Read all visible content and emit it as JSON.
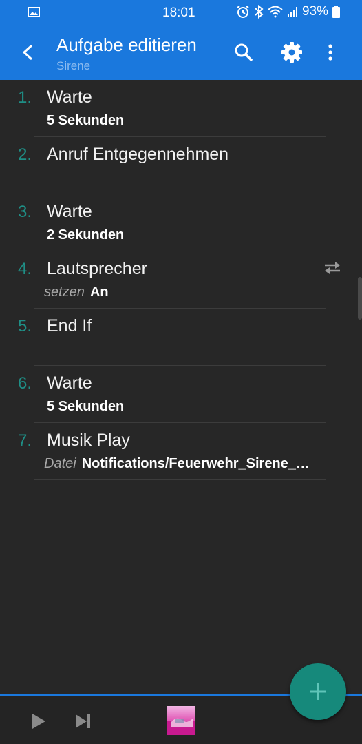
{
  "status_bar": {
    "time": "18:01",
    "battery": "93%"
  },
  "app_bar": {
    "title": "Aufgabe editieren",
    "subtitle": "Sirene"
  },
  "actions": [
    {
      "number": "1.",
      "name": "Warte",
      "detail_key": "",
      "detail_value": "5 Sekunden"
    },
    {
      "number": "2.",
      "name": "Anruf Entgegennehmen",
      "detail_key": "",
      "detail_value": ""
    },
    {
      "number": "3.",
      "name": "Warte",
      "detail_key": "",
      "detail_value": "2 Sekunden"
    },
    {
      "number": "4.",
      "name": "Lautsprecher",
      "detail_key": "setzen",
      "detail_value": "An"
    },
    {
      "number": "5.",
      "name": "End If",
      "detail_key": "",
      "detail_value": ""
    },
    {
      "number": "6.",
      "name": "Warte",
      "detail_key": "",
      "detail_value": "5 Sekunden"
    },
    {
      "number": "7.",
      "name": "Musik Play",
      "detail_key": "Datei",
      "detail_value": "Notifications/Feuerwehr_Sirene_…"
    }
  ],
  "colors": {
    "accent": "#1a78dd",
    "number": "#1f8f86",
    "fab": "#16897b",
    "background": "#272727"
  },
  "icons": [
    "image-icon",
    "alarm-icon",
    "bluetooth-icon",
    "wifi-icon",
    "signal-icon",
    "battery-icon",
    "back-arrow-icon",
    "search-icon",
    "settings-icon",
    "more-vert-icon",
    "swap-icon",
    "play-icon",
    "skip-next-icon",
    "plus-icon"
  ]
}
